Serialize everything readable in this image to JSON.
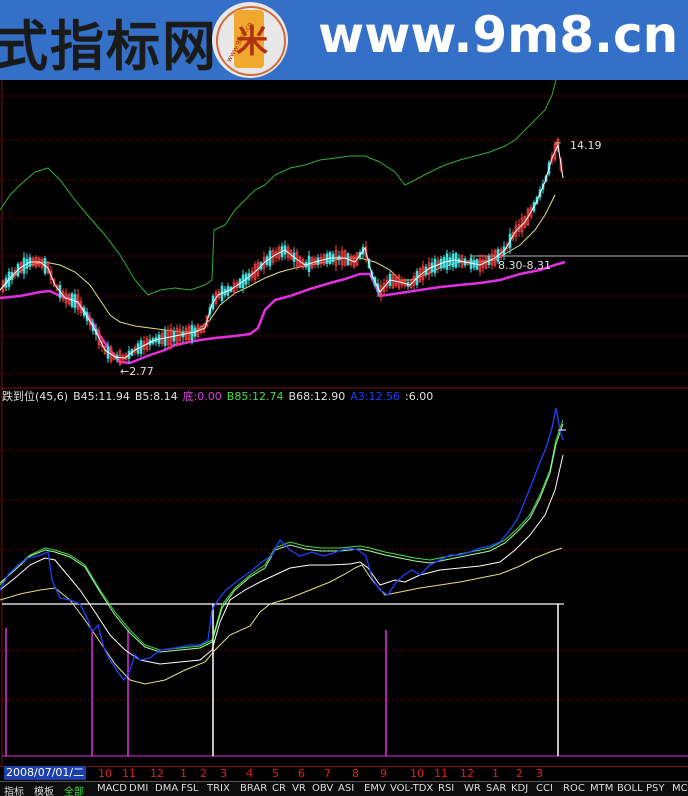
{
  "banner": {
    "left_text": "式指标网",
    "url": "www.9m8.cn",
    "logo_char": "米",
    "logo_url": "www.9m8.cn"
  },
  "upper_chart": {
    "high_label": "14.19",
    "low_label": "←2.77",
    "mid_label": "8.30-8.31"
  },
  "indicator": {
    "title": "跌到位(45,6)",
    "items": [
      {
        "label": "B45:11.94",
        "color": "#e0e0e0"
      },
      {
        "label": "B5:8.14",
        "color": "#e0e0e0"
      },
      {
        "label": "底:0.00",
        "color": "#e040e0"
      },
      {
        "label": "B85:12.74",
        "color": "#40e040"
      },
      {
        "label": "B68:12.90",
        "color": "#e0e0e0"
      },
      {
        "label": "A3:12.56",
        "color": "#2040ff"
      },
      {
        "label": ":6.00",
        "color": "#e0e0e0"
      }
    ]
  },
  "timebar": {
    "date": "2008/07/01/二",
    "months": [
      "10",
      "11",
      "12",
      "1",
      "2",
      "3",
      "4",
      "5",
      "6",
      "7",
      "8",
      "9",
      "10",
      "11",
      "12",
      "1",
      "2",
      "3"
    ]
  },
  "tabs": [
    "指标",
    "模板",
    "全部",
    "MACD",
    "DMI",
    "DMA",
    "FSL",
    "TRIX",
    "BRAR",
    "CR",
    "VR",
    "OBV",
    "ASI",
    "EMV",
    "VOL-TDX",
    "RSI",
    "WR",
    "SAR",
    "KDJ",
    "CCI",
    "ROC",
    "MTM",
    "BOLL",
    "PSY",
    "MC"
  ],
  "colors": {
    "grid": "#7a1010",
    "banner_bg": "#3570c8",
    "magenta": "#e030e0",
    "green": "#40c040",
    "yellow": "#e0e080"
  }
}
